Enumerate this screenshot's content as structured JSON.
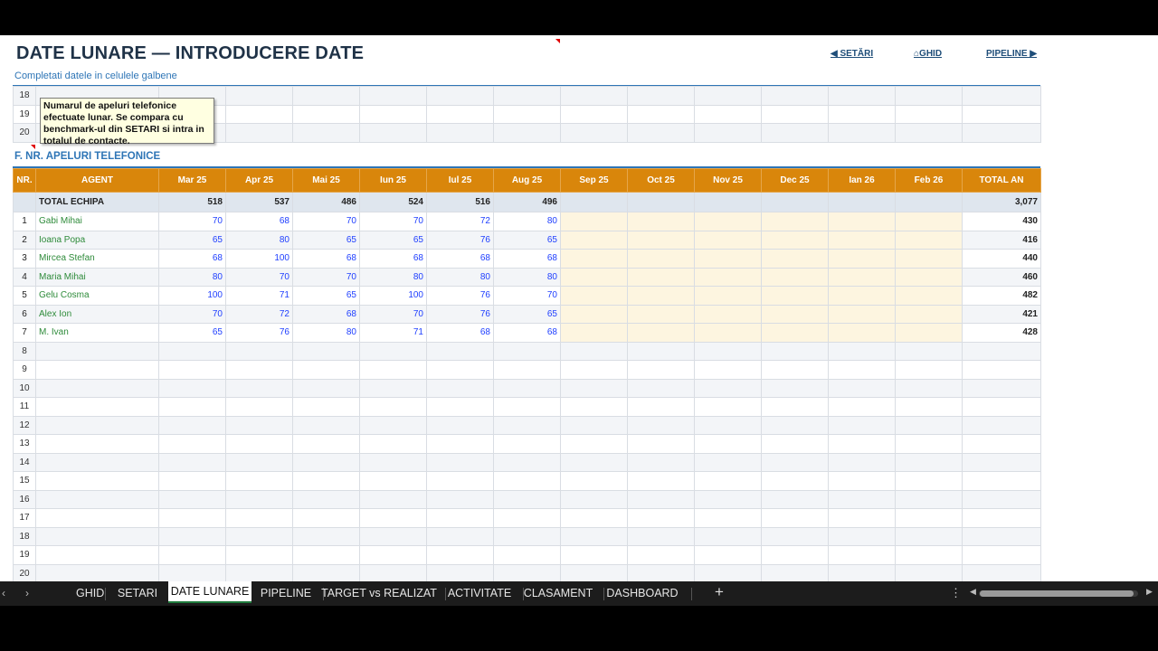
{
  "header": {
    "title": "DATE LUNARE — INTRODUCERE DATE",
    "subtitle": "Completati datele in celulele galbene",
    "nav_setari": "◀ SETĂRI",
    "nav_ghid": "⌂GHID",
    "nav_pipeline": "PIPELINE ▶"
  },
  "top_rows": [
    "18",
    "19",
    "20"
  ],
  "tooltip": {
    "text": "Numarul de apeluri telefonice efectuate lunar. Se compara cu benchmark-ul din SETARI si intra in totalul de contacte."
  },
  "section": {
    "title": "F. NR. APELURI TELEFONICE"
  },
  "table": {
    "headers": [
      "NR.",
      "AGENT",
      "Mar 25",
      "Apr 25",
      "Mai 25",
      "Iun 25",
      "Iul 25",
      "Aug 25",
      "Sep 25",
      "Oct 25",
      "Nov 25",
      "Dec 25",
      "Ian 26",
      "Feb 26",
      "TOTAL AN"
    ],
    "total_row": {
      "label": "TOTAL ECHIPA",
      "values": [
        "518",
        "537",
        "486",
        "524",
        "516",
        "496",
        "",
        "",
        "",
        "",
        "",
        ""
      ],
      "total": "3,077"
    },
    "agents": [
      {
        "nr": "1",
        "name": "Gabi Mihai",
        "values": [
          "70",
          "68",
          "70",
          "70",
          "72",
          "80"
        ],
        "total": "430"
      },
      {
        "nr": "2",
        "name": "Ioana Popa",
        "values": [
          "65",
          "80",
          "65",
          "65",
          "76",
          "65"
        ],
        "total": "416"
      },
      {
        "nr": "3",
        "name": "Mircea Stefan",
        "values": [
          "68",
          "100",
          "68",
          "68",
          "68",
          "68"
        ],
        "total": "440"
      },
      {
        "nr": "4",
        "name": "Maria Mihai",
        "values": [
          "80",
          "70",
          "70",
          "80",
          "80",
          "80"
        ],
        "total": "460"
      },
      {
        "nr": "5",
        "name": "Gelu Cosma",
        "values": [
          "100",
          "71",
          "65",
          "100",
          "76",
          "70"
        ],
        "total": "482"
      },
      {
        "nr": "6",
        "name": "Alex Ion",
        "values": [
          "70",
          "72",
          "68",
          "70",
          "76",
          "65"
        ],
        "total": "421"
      },
      {
        "nr": "7",
        "name": "M. Ivan",
        "values": [
          "65",
          "76",
          "80",
          "71",
          "68",
          "68"
        ],
        "total": "428"
      }
    ],
    "blank_rows": [
      "8",
      "9",
      "10",
      "11",
      "12",
      "13",
      "14",
      "15",
      "16",
      "17",
      "18",
      "19",
      "20"
    ]
  },
  "tabs": [
    {
      "label": "GHID",
      "active": false
    },
    {
      "label": "SETARI",
      "active": false
    },
    {
      "label": "DATE LUNARE",
      "active": true
    },
    {
      "label": "PIPELINE",
      "active": false
    },
    {
      "label": "TARGET vs REALIZAT",
      "active": false
    },
    {
      "label": "ACTIVITATE",
      "active": false
    },
    {
      "label": "CLASAMENT",
      "active": false
    },
    {
      "label": "DASHBOARD",
      "active": false
    }
  ],
  "icons": {
    "prev": "chevron-left-icon",
    "next": "chevron-right-icon",
    "add": "plus-icon",
    "more": "more-vertical-icon"
  },
  "colors": {
    "header_bg": "#d9860b",
    "title": "#1f3247",
    "accent": "#2e75b6",
    "input_fill": "#fdf5e0",
    "agent_name": "#2e8b3a",
    "value_blue": "#1f3fff",
    "active_tab_underline": "#1e7a3c"
  }
}
